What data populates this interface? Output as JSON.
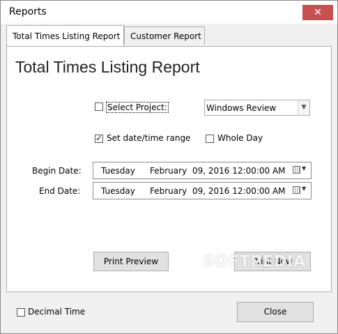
{
  "window": {
    "title": "Reports",
    "close_glyph": "✕"
  },
  "tabs": [
    {
      "label": "Total Times Listing Report",
      "active": true
    },
    {
      "label": "Customer Report",
      "active": false
    }
  ],
  "report": {
    "heading": "Total Times Listing Report",
    "select_project": {
      "label": "Select Project:",
      "checked": false
    },
    "project_combo": {
      "value": "Windows Review"
    },
    "set_date_range": {
      "label": "Set date/time range",
      "checked": true
    },
    "whole_day": {
      "label": "Whole Day",
      "checked": false
    },
    "begin_date": {
      "label": "Begin Date:",
      "weekday": "Tuesday",
      "month": "February",
      "rest": "09, 2016 12:00:00 AM"
    },
    "end_date": {
      "label": "End Date:",
      "weekday": "Tuesday",
      "month": "February",
      "rest": "09, 2016 12:00:00 AM"
    },
    "print_preview_label": "Print Preview",
    "print_now_label": "Print Now"
  },
  "footer": {
    "decimal_time": {
      "label": "Decimal Time",
      "checked": false
    },
    "close_label": "Close"
  },
  "watermark": "SOFTPEDIA"
}
